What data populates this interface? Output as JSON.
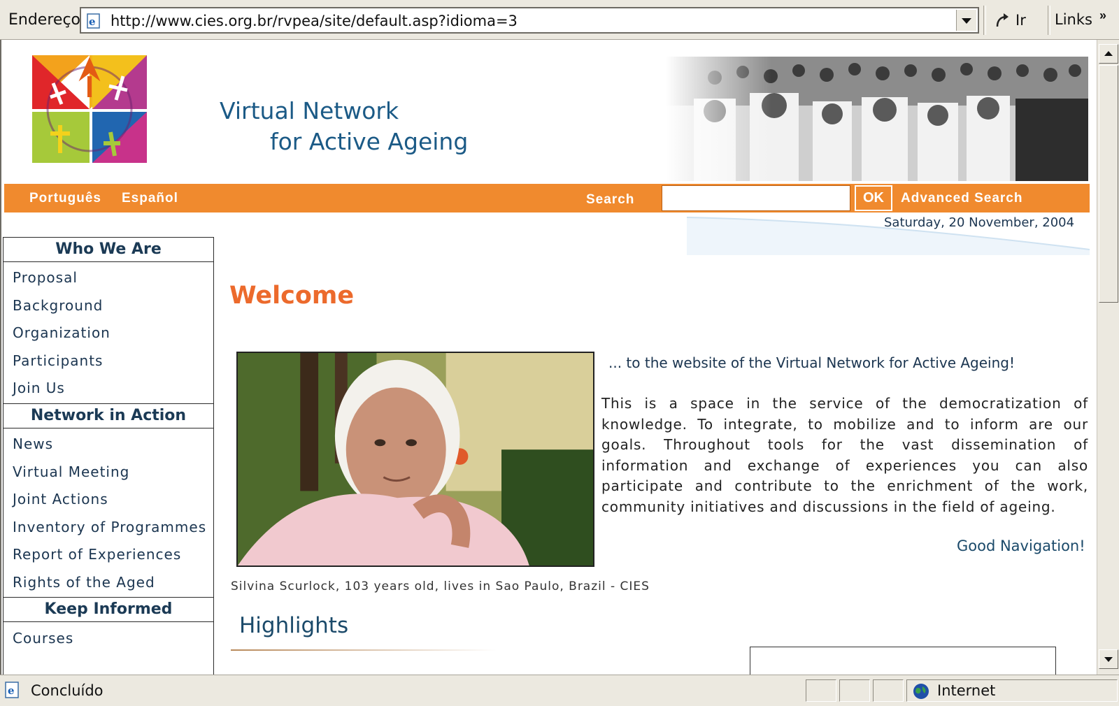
{
  "browser": {
    "address_label": "Endereço",
    "url": "http://www.cies.org.br/rvpea/site/default.asp?idioma=3",
    "go_label": "Ir",
    "links_label": "Links",
    "status_text": "Concluído",
    "zone_text": "Internet"
  },
  "header": {
    "title_line1": "Virtual Network",
    "title_line2": "for Active Ageing"
  },
  "topbar": {
    "lang_pt": "Português",
    "lang_es": "Español",
    "search_label": "Search",
    "search_value": "",
    "ok_label": "OK",
    "advanced_search": "Advanced Search",
    "date": "Saturday, 20 November, 2004"
  },
  "sidebar": {
    "sections": [
      {
        "title": "Who We Are",
        "items": [
          "Proposal",
          "Background",
          "Organization",
          "Participants",
          "Join Us"
        ]
      },
      {
        "title": "Network in Action",
        "items": [
          "News",
          "Virtual Meeting",
          "Joint Actions",
          "Inventory of Programmes",
          "Report of Experiences",
          "Rights of the Aged"
        ]
      },
      {
        "title": "Keep Informed",
        "items": [
          "Courses"
        ]
      }
    ]
  },
  "main": {
    "welcome": "Welcome",
    "tagline": "... to the website of the Virtual Network for Active Ageing!",
    "intro": "This is a space in the service of the democratization of knowledge. To integrate, to mobilize and to inform are our goals. Throughout tools for the vast dissemination of information and exchange of experiences you can also participate and contribute to the enrichment of the work, community initiatives and discussions in the field of ageing.",
    "good_navigation": "Good Navigation!",
    "photo_caption": "Silvina Scurlock, 103 years old, lives in Sao Paulo, Brazil - CIES",
    "highlights": "Highlights"
  },
  "colors": {
    "orange": "#f08a2e",
    "welcome_orange": "#ec6a2c",
    "navy": "#1b5a86"
  }
}
